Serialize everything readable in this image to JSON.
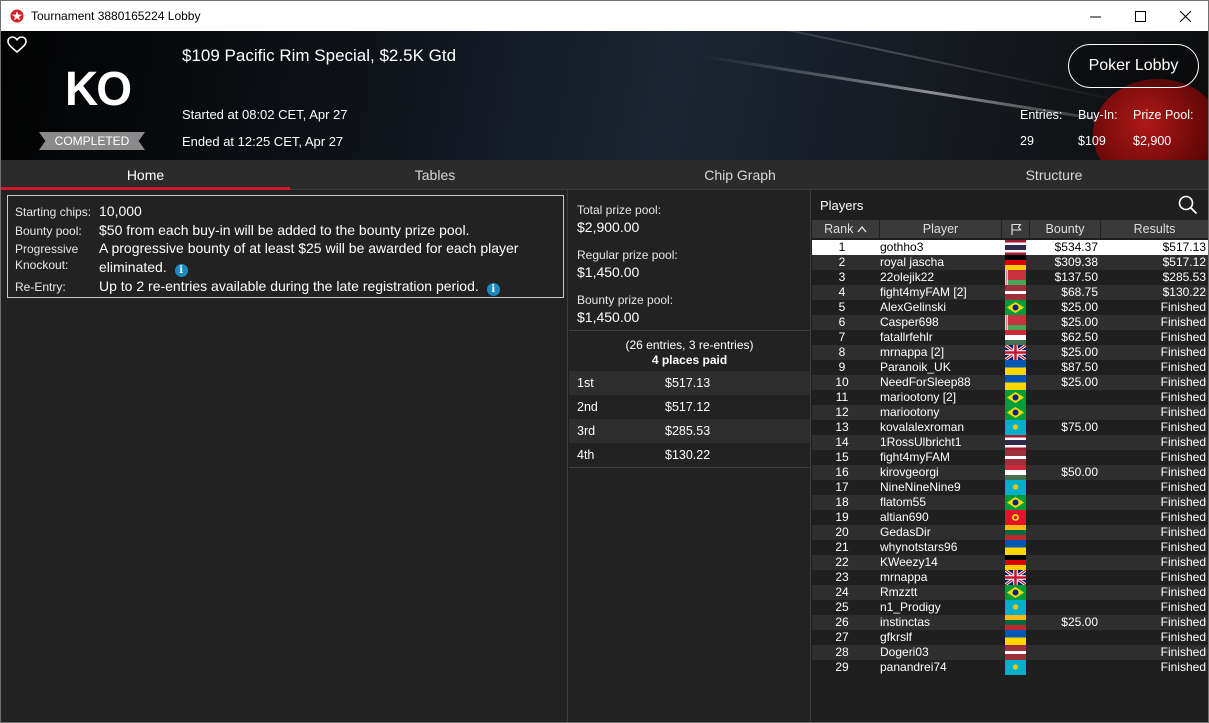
{
  "window": {
    "title": "Tournament 3880165224 Lobby"
  },
  "header": {
    "badge": "KO",
    "status": "COMPLETED",
    "tournament_name": "$109 Pacific Rim Special, $2.5K Gtd",
    "started": "Started at 08:02 CET, Apr 27",
    "ended": "Ended at 12:25 CET, Apr 27",
    "poker_lobby_label": "Poker Lobby",
    "entries_label": "Entries:",
    "entries_value": "29",
    "buyin_label": "Buy-In:",
    "buyin_value": "$109",
    "prizepool_label": "Prize Pool:",
    "prizepool_value": "$2,900"
  },
  "tabs": [
    "Home",
    "Tables",
    "Chip Graph",
    "Structure"
  ],
  "info": {
    "starting_chips_label": "Starting chips:",
    "starting_chips_value": "10,000",
    "bounty_pool_label": "Bounty pool:",
    "bounty_pool_value": "$50 from each buy-in will be added to the bounty prize pool.",
    "progressive_label_1": "Progressive",
    "progressive_label_2": "Knockout:",
    "progressive_value": "A progressive bounty of at least $25 will be awarded for each player eliminated.",
    "reentry_label": "Re-Entry:",
    "reentry_value": "Up to 2 re-entries available during the late registration period."
  },
  "prizes": {
    "total_label": "Total prize pool:",
    "total_value": "$2,900.00",
    "regular_label": "Regular prize pool:",
    "regular_value": "$1,450.00",
    "bounty_label": "Bounty prize pool:",
    "bounty_value": "$1,450.00",
    "entries_text": "(26 entries, 3 re-entries)",
    "places_text": "4 places paid",
    "payouts": [
      {
        "place": "1st",
        "amount": "$517.13"
      },
      {
        "place": "2nd",
        "amount": "$517.12"
      },
      {
        "place": "3rd",
        "amount": "$285.53"
      },
      {
        "place": "4th",
        "amount": "$130.22"
      }
    ]
  },
  "players": {
    "title": "Players",
    "columns": {
      "rank": "Rank",
      "player": "Player",
      "bounty": "Bounty",
      "results": "Results"
    },
    "rows": [
      {
        "rank": "1",
        "name": "gothho3",
        "flag": "thailand",
        "bounty": "$534.37",
        "result": "$517.13"
      },
      {
        "rank": "2",
        "name": "royal jascha",
        "flag": "germany",
        "bounty": "$309.38",
        "result": "$517.12"
      },
      {
        "rank": "3",
        "name": "22olejik22",
        "flag": "belarus",
        "bounty": "$137.50",
        "result": "$285.53"
      },
      {
        "rank": "4",
        "name": "fight4myFAM [2]",
        "flag": "latvia",
        "bounty": "$68.75",
        "result": "$130.22"
      },
      {
        "rank": "5",
        "name": "AlexGelinski",
        "flag": "brazil",
        "bounty": "$25.00",
        "result": "Finished"
      },
      {
        "rank": "6",
        "name": "Casper698",
        "flag": "belarus",
        "bounty": "$25.00",
        "result": "Finished"
      },
      {
        "rank": "7",
        "name": "fatallrfehlr",
        "flag": "hungary",
        "bounty": "$62.50",
        "result": "Finished"
      },
      {
        "rank": "8",
        "name": "mrnappa [2]",
        "flag": "uk",
        "bounty": "$25.00",
        "result": "Finished"
      },
      {
        "rank": "9",
        "name": "Paranoik_UK",
        "flag": "ukraine",
        "bounty": "$87.50",
        "result": "Finished"
      },
      {
        "rank": "10",
        "name": "NeedForSleep88",
        "flag": "ukraine",
        "bounty": "$25.00",
        "result": "Finished"
      },
      {
        "rank": "11",
        "name": "mariootony [2]",
        "flag": "brazil",
        "bounty": "",
        "result": "Finished"
      },
      {
        "rank": "12",
        "name": "mariootony",
        "flag": "brazil",
        "bounty": "",
        "result": "Finished"
      },
      {
        "rank": "13",
        "name": "kovalalexroman",
        "flag": "kazakhstan",
        "bounty": "$75.00",
        "result": "Finished"
      },
      {
        "rank": "14",
        "name": "1RossUlbricht1",
        "flag": "thailand",
        "bounty": "",
        "result": "Finished"
      },
      {
        "rank": "15",
        "name": "fight4myFAM",
        "flag": "latvia",
        "bounty": "",
        "result": "Finished"
      },
      {
        "rank": "16",
        "name": "kirovgeorgi",
        "flag": "hungary",
        "bounty": "$50.00",
        "result": "Finished"
      },
      {
        "rank": "17",
        "name": "NineNineNine9",
        "flag": "kazakhstan",
        "bounty": "",
        "result": "Finished"
      },
      {
        "rank": "18",
        "name": "flatom55",
        "flag": "brazil",
        "bounty": "",
        "result": "Finished"
      },
      {
        "rank": "19",
        "name": "altian690",
        "flag": "kyrgyzstan",
        "bounty": "",
        "result": "Finished"
      },
      {
        "rank": "20",
        "name": "GedasDir",
        "flag": "lithuania",
        "bounty": "",
        "result": "Finished"
      },
      {
        "rank": "21",
        "name": "whynotstars96",
        "flag": "ukraine",
        "bounty": "",
        "result": "Finished"
      },
      {
        "rank": "22",
        "name": "KWeezy14",
        "flag": "germany",
        "bounty": "",
        "result": "Finished"
      },
      {
        "rank": "23",
        "name": "mrnappa",
        "flag": "uk",
        "bounty": "",
        "result": "Finished"
      },
      {
        "rank": "24",
        "name": "Rmzztt",
        "flag": "brazil",
        "bounty": "",
        "result": "Finished"
      },
      {
        "rank": "25",
        "name": "n1_Prodigy",
        "flag": "kazakhstan",
        "bounty": "",
        "result": "Finished"
      },
      {
        "rank": "26",
        "name": "instinctas",
        "flag": "lithuania",
        "bounty": "$25.00",
        "result": "Finished"
      },
      {
        "rank": "27",
        "name": "gfkrslf",
        "flag": "ukraine",
        "bounty": "",
        "result": "Finished"
      },
      {
        "rank": "28",
        "name": "Dogeri03",
        "flag": "latvia",
        "bounty": "",
        "result": "Finished"
      },
      {
        "rank": "29",
        "name": "panandrei74",
        "flag": "kazakhstan",
        "bounty": "",
        "result": "Finished"
      }
    ]
  },
  "colors": {
    "accent": "#d4162b",
    "selected_row": "#ffffff",
    "info_icon": "#1a8ac0"
  }
}
